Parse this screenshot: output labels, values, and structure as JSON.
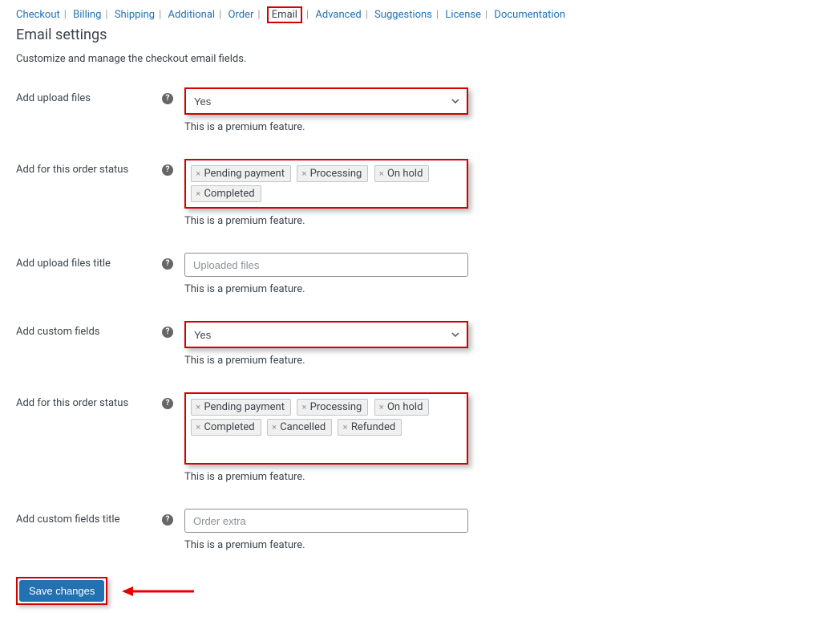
{
  "nav": {
    "tabs": [
      "Checkout",
      "Billing",
      "Shipping",
      "Additional",
      "Order",
      "Email",
      "Advanced",
      "Suggestions",
      "License",
      "Documentation"
    ],
    "active": "Email"
  },
  "page": {
    "title": "Email settings",
    "subtitle": "Customize and manage the checkout email fields.",
    "premium_note": "This is a premium feature."
  },
  "fields": {
    "add_upload_files": {
      "label": "Add upload files",
      "value": "Yes"
    },
    "status1": {
      "label": "Add for this order status",
      "tags": [
        "Pending payment",
        "Processing",
        "On hold",
        "Completed"
      ]
    },
    "upload_title": {
      "label": "Add upload files title",
      "placeholder": "Uploaded files",
      "value": ""
    },
    "add_custom_fields": {
      "label": "Add custom fields",
      "value": "Yes"
    },
    "status2": {
      "label": "Add for this order status",
      "tags": [
        "Pending payment",
        "Processing",
        "On hold",
        "Completed",
        "Cancelled",
        "Refunded"
      ]
    },
    "custom_title": {
      "label": "Add custom fields title",
      "placeholder": "Order extra",
      "value": ""
    }
  },
  "actions": {
    "save": "Save changes"
  }
}
